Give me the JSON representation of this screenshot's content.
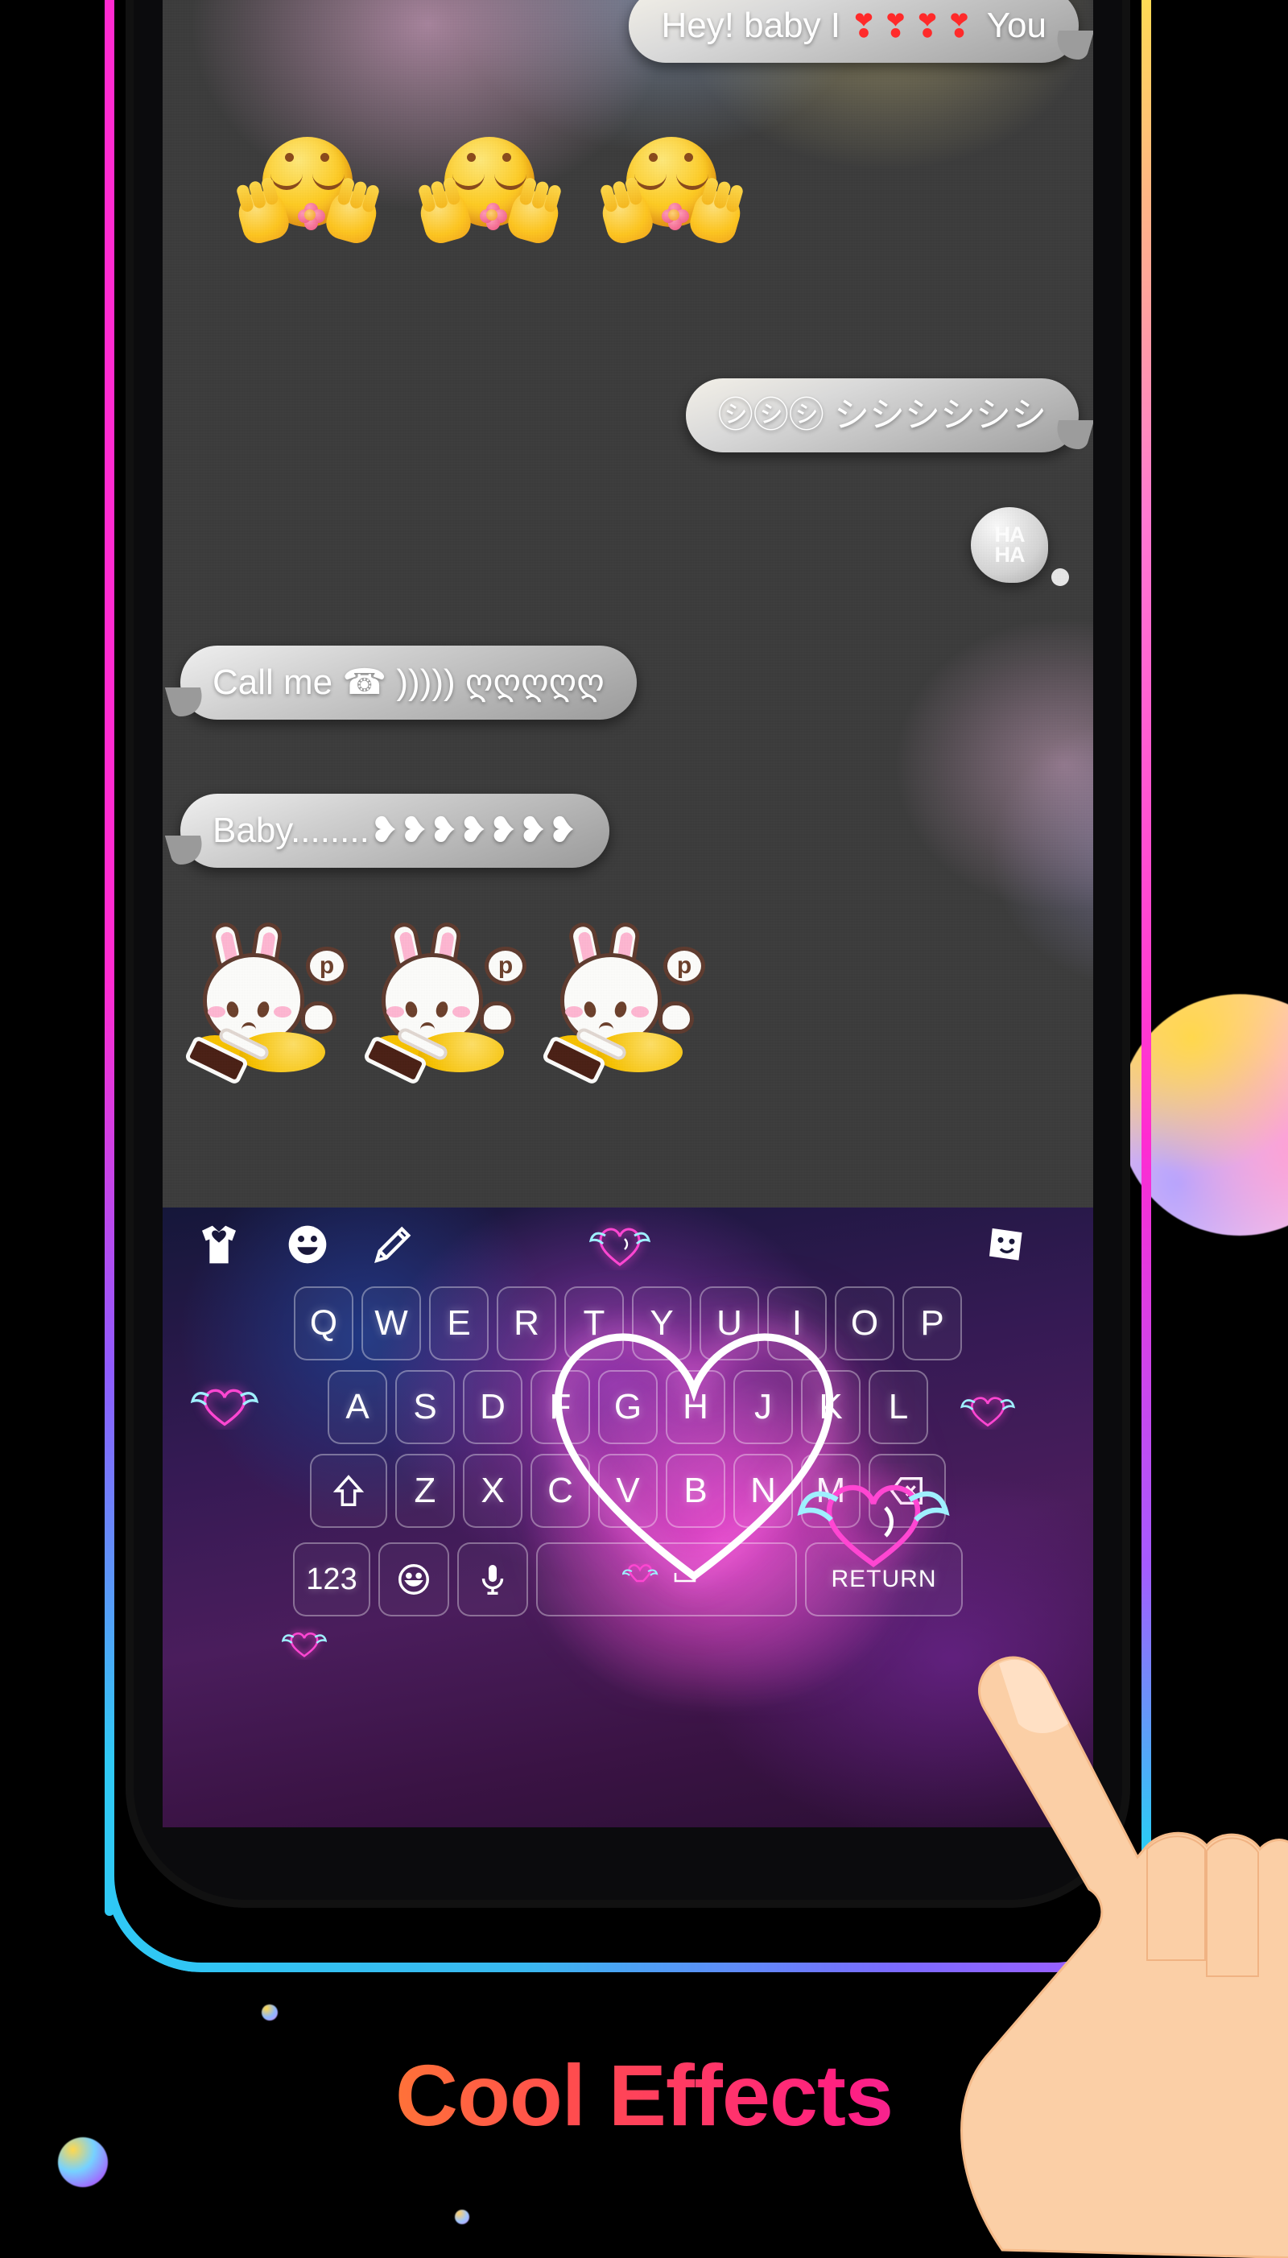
{
  "promo": {
    "tagline": "Cool Effects",
    "accent_pink": "#ff2bd1",
    "accent_cyan": "#2fc9f5",
    "accent_yellow": "#ffc400",
    "accent_purple": "#8f4bd8"
  },
  "chat": {
    "background_color": "#3b3b3b",
    "messages": [
      {
        "id": "msg-1",
        "side": "out",
        "type": "text",
        "text_before": "Hey! baby I ",
        "emoji": "❣❣❣❣",
        "text_after": " You"
      },
      {
        "id": "msg-2",
        "side": "left",
        "type": "sticker",
        "sticker": "emoji-face-flower",
        "count": 3
      },
      {
        "id": "msg-3",
        "side": "out",
        "type": "text",
        "text_before": "㋛㋛㋛ シシシシシシ",
        "emoji": "",
        "text_after": ""
      },
      {
        "id": "msg-4",
        "side": "out",
        "type": "haha",
        "line1": "HA",
        "line2": "HA"
      },
      {
        "id": "msg-5",
        "side": "in",
        "type": "text",
        "text_before": "Call me ☎ ))))) ღღღღღ",
        "emoji": "",
        "text_after": ""
      },
      {
        "id": "msg-6",
        "side": "in",
        "type": "text",
        "text_before": "Baby........❥❥❥❥❥❥❥",
        "emoji": "",
        "text_after": ""
      },
      {
        "id": "msg-7",
        "side": "left",
        "type": "sticker",
        "sticker": "bunny-phone",
        "count": 3
      }
    ],
    "bunny_zzz": "р"
  },
  "keyboard": {
    "theme_name": "neon-heart-wings",
    "toolbar": [
      {
        "name": "theme-shirt-icon",
        "label": "Theme"
      },
      {
        "name": "emoji-smiley-icon",
        "label": "Emoji"
      },
      {
        "name": "pencil-edit-icon",
        "label": "Edit"
      },
      {
        "name": "winged-heart-icon",
        "label": "Effect"
      },
      {
        "name": "sticker-face-icon",
        "label": "Sticker"
      }
    ],
    "row1": [
      "Q",
      "W",
      "E",
      "R",
      "T",
      "Y",
      "U",
      "I",
      "O",
      "P"
    ],
    "row2": [
      "A",
      "S",
      "D",
      "F",
      "G",
      "H",
      "J",
      "K",
      "L"
    ],
    "row3_letters": [
      "Z",
      "X",
      "C",
      "V",
      "B",
      "N",
      "M"
    ],
    "shift_key": "shift-key",
    "backspace_key": "backspace-key",
    "bottom_row": {
      "numbers": "123",
      "emoji_key": "emoji-key",
      "mic_key": "mic-key",
      "effect_key": "winged-heart-key",
      "space_key": "space-key",
      "return_key": "RETURN"
    }
  },
  "hand": {
    "name": "pointing-hand-cursor",
    "target_key": "M"
  }
}
